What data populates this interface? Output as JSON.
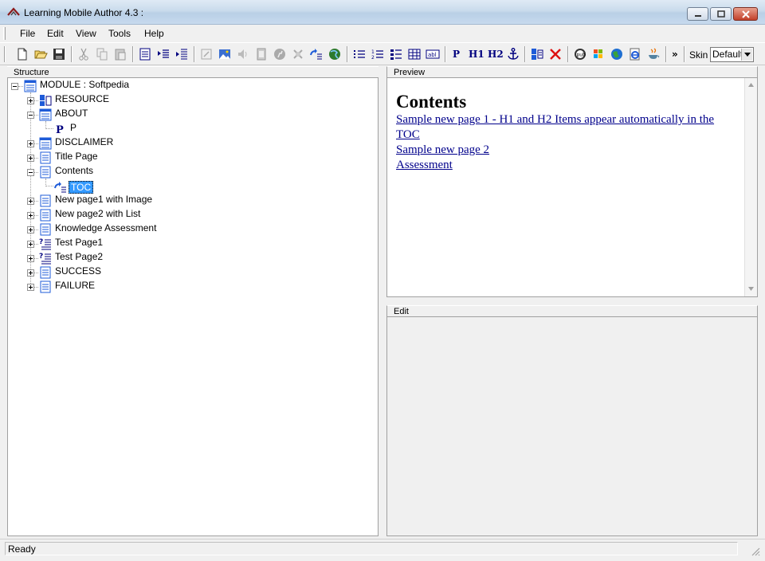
{
  "window": {
    "title": "Learning Mobile Author 4.3 :"
  },
  "menu": [
    "File",
    "Edit",
    "View",
    "Tools",
    "Help"
  ],
  "toolbar": {
    "text_buttons": {
      "p": "P",
      "h1": "H1",
      "h2": "H2"
    },
    "overflow": "»",
    "skin_label": "Skin",
    "skin_value": "Default"
  },
  "structure": {
    "header": "Structure",
    "root": "MODULE : Softpedia",
    "nodes": [
      {
        "label": "RESOURCE",
        "icon": "resource-icon"
      },
      {
        "label": "ABOUT",
        "icon": "module-page-icon"
      },
      {
        "label": "P",
        "icon": "paragraph-icon"
      },
      {
        "label": "DISCLAIMER",
        "icon": "module-page-icon"
      },
      {
        "label": "Title Page",
        "icon": "page-icon"
      },
      {
        "label": "Contents",
        "icon": "page-icon"
      },
      {
        "label": "TOC",
        "icon": "toc-icon"
      },
      {
        "label": "New page1 with Image",
        "icon": "page-icon"
      },
      {
        "label": "New page2 with List",
        "icon": "page-icon"
      },
      {
        "label": "Knowledge Assessment",
        "icon": "page-icon"
      },
      {
        "label": "Test Page1",
        "icon": "test-page-icon"
      },
      {
        "label": "Test Page2",
        "icon": "test-page-icon"
      },
      {
        "label": "SUCCESS",
        "icon": "page-icon"
      },
      {
        "label": "FAILURE",
        "icon": "page-icon"
      }
    ]
  },
  "preview": {
    "header": "Preview",
    "title": "Contents",
    "links": [
      "Sample new page 1 - H1 and H2 Items appear automatically in the TOC",
      "Sample new page 2",
      "Assessment"
    ]
  },
  "edit": {
    "header": "Edit"
  },
  "status": {
    "text": "Ready"
  },
  "colors": {
    "selection": "#3399ff",
    "link": "#00008b",
    "toolbar_text": "#00007f"
  }
}
